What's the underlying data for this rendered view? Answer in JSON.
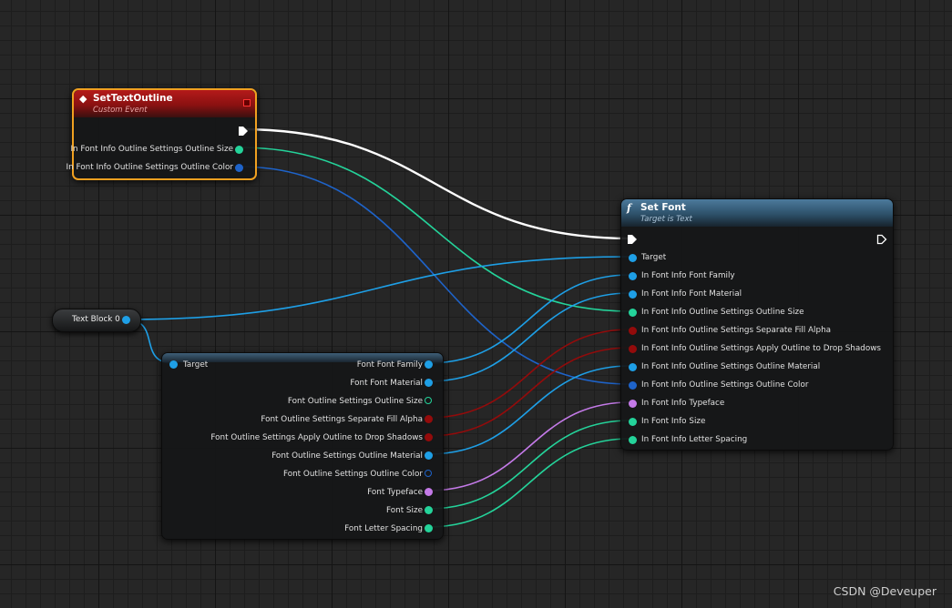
{
  "colors": {
    "exec": "#ffffff",
    "float": "#24d39a",
    "object": "#1e9fe6",
    "linear_color": "#1e63c9",
    "bool": "#930b0b",
    "font_object": "#c47ae8",
    "event_header": "#b41a1a",
    "function_header": "#3c6a8c",
    "selection": "#f0a020"
  },
  "event_node": {
    "title": "SetTextOutline",
    "subtitle": "Custom Event",
    "icon": "event-diamond-icon",
    "outputs": [
      {
        "label": "In Font Info Outline Settings Outline Size",
        "type": "float"
      },
      {
        "label": "In Font Info Outline Settings Outline Color",
        "type": "linear_color"
      }
    ]
  },
  "variable_node": {
    "label": "Text Block 0"
  },
  "break_node": {
    "input": {
      "label": "Target",
      "type": "object"
    },
    "outputs": [
      {
        "label": "Font Font Family",
        "type": "object"
      },
      {
        "label": "Font Font Material",
        "type": "object"
      },
      {
        "label": "Font Outline Settings Outline Size",
        "type": "float"
      },
      {
        "label": "Font Outline Settings Separate Fill Alpha",
        "type": "bool"
      },
      {
        "label": "Font Outline Settings Apply Outline to Drop Shadows",
        "type": "bool"
      },
      {
        "label": "Font Outline Settings Outline Material",
        "type": "object"
      },
      {
        "label": "Font Outline Settings Outline Color",
        "type": "linear_color"
      },
      {
        "label": "Font Typeface",
        "type": "font_object"
      },
      {
        "label": "Font Size",
        "type": "float"
      },
      {
        "label": "Font Letter Spacing",
        "type": "float"
      }
    ]
  },
  "function_node": {
    "title": "Set Font",
    "subtitle": "Target is Text",
    "icon": "function-icon",
    "inputs": [
      {
        "label": "Target",
        "type": "object"
      },
      {
        "label": "In Font Info Font Family",
        "type": "object"
      },
      {
        "label": "In Font Info Font Material",
        "type": "object"
      },
      {
        "label": "In Font Info Outline Settings Outline Size",
        "type": "float"
      },
      {
        "label": "In Font Info Outline Settings Separate Fill Alpha",
        "type": "bool"
      },
      {
        "label": "In Font Info Outline Settings Apply Outline to Drop Shadows",
        "type": "bool"
      },
      {
        "label": "In Font Info Outline Settings Outline Material",
        "type": "object"
      },
      {
        "label": "In Font Info Outline Settings Outline Color",
        "type": "linear_color"
      },
      {
        "label": "In Font Info Typeface",
        "type": "font_object"
      },
      {
        "label": "In Font Info Size",
        "type": "float"
      },
      {
        "label": "In Font Info Letter Spacing",
        "type": "float"
      }
    ]
  },
  "watermark": "CSDN @Deveuper"
}
